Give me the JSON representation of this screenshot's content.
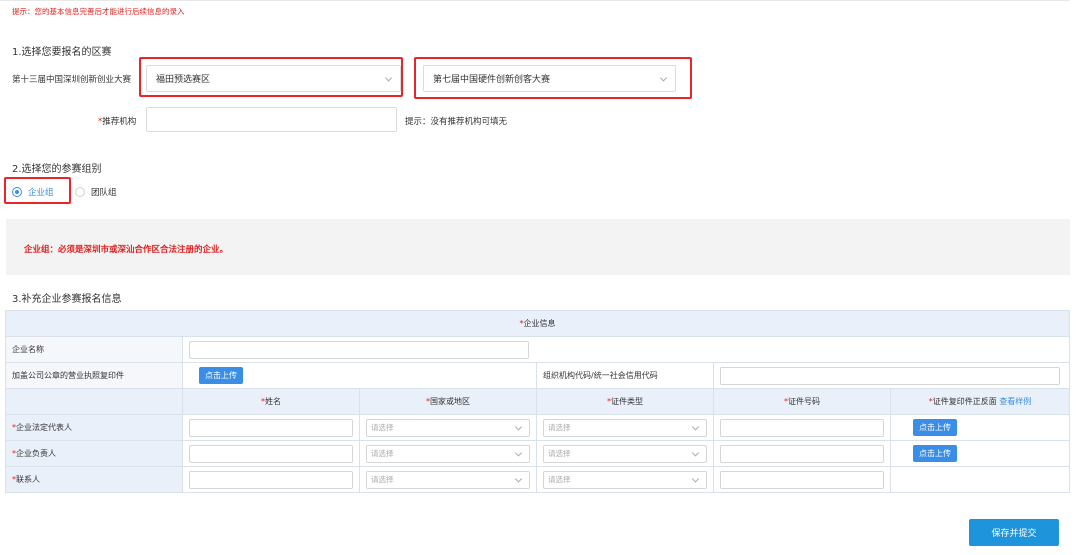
{
  "hint": "提示：您的基本信息完善后才能进行后续信息的录入",
  "section1": {
    "title": "1.选择您要报名的区赛",
    "competition_label": "第十三届中国深圳创新创业大赛",
    "district_select": "福田预选赛区",
    "sub_competition_select": "第七届中国硬件创新创客大赛",
    "recommender_label": "推荐机构",
    "recommender_value": "",
    "recommender_hint": "提示：没有推荐机构可填无",
    "required_mark": "*"
  },
  "section2": {
    "title": "2.选择您的参赛组别",
    "options": [
      {
        "label": "企业组",
        "selected": true
      },
      {
        "label": "团队组",
        "selected": false
      }
    ],
    "notice": "企业组：必须是深圳市或深汕合作区合法注册的企业。"
  },
  "section3": {
    "title": "3.补充企业参赛报名信息",
    "table_header": "企业信息",
    "company_name_label": "企业名称",
    "company_name_value": "",
    "license_label": "加盖公司公章的营业执照复印件",
    "upload_label": "点击上传",
    "org_code_label": "组织机构代码/统一社会信用代码",
    "org_code_value": "",
    "columns": [
      "姓名",
      "国家或地区",
      "证件类型",
      "证件号码",
      "证件复印件正反面"
    ],
    "view_sample": "查看样例",
    "select_placeholder": "请选择",
    "rows": [
      {
        "label": "企业法定代表人",
        "has_upload": true
      },
      {
        "label": "企业负责人",
        "has_upload": true
      },
      {
        "label": "联系人",
        "has_upload": false
      }
    ]
  },
  "submit_label": "保存并提交",
  "colors": {
    "accent": "#3a8ee6",
    "warning": "#e02020",
    "highlight_box": "#e8262a",
    "submit": "#1e95db"
  }
}
